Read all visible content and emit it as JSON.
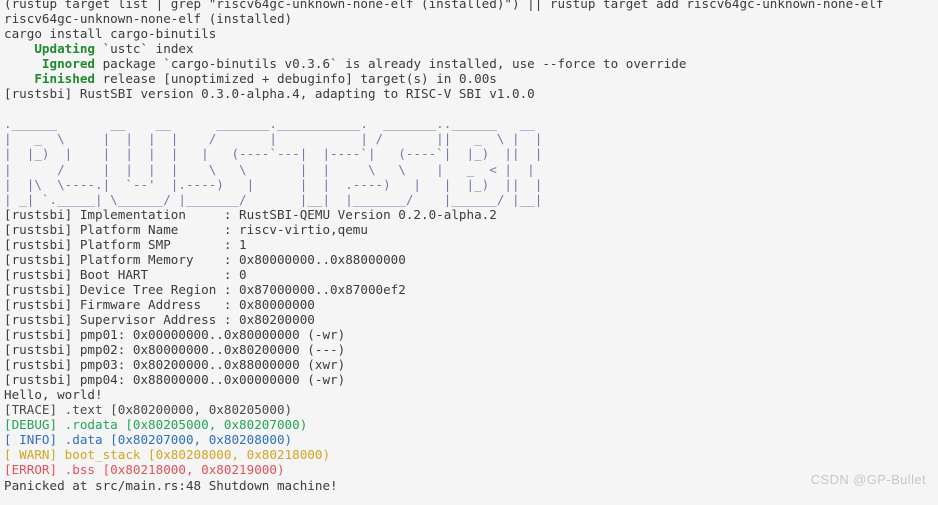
{
  "terminal": {
    "background_color": "#f5f5f5",
    "foreground_color": "#3b3b3b",
    "ascii_art_color": "#6b7da8",
    "colors": {
      "green": "#1f8a2e",
      "trace": "#4a4a4a",
      "debug": "#23a455",
      "info": "#2b6fc4",
      "warn": "#d3a520",
      "error": "#e05260",
      "watermark": "#c7c7c7"
    },
    "lines": [
      {
        "id": "cmd-rustup-target",
        "segments": [
          {
            "text": "(rustup target list | grep \"riscv64gc-unknown-none-elf (installed)\") || rustup target add riscv64gc-unknown-none-elf",
            "style": "c-default"
          }
        ]
      },
      {
        "id": "out-target-installed",
        "segments": [
          {
            "text": "riscv64gc-unknown-none-elf (installed)",
            "style": "c-default"
          }
        ]
      },
      {
        "id": "cmd-cargo-install",
        "segments": [
          {
            "text": "cargo install cargo-binutils",
            "style": "c-default"
          }
        ]
      },
      {
        "id": "out-updating",
        "segments": [
          {
            "text": "    ",
            "style": "c-default"
          },
          {
            "text": "Updating",
            "style": "c-green"
          },
          {
            "text": " `ustc` index",
            "style": "c-default"
          }
        ]
      },
      {
        "id": "out-ignored",
        "segments": [
          {
            "text": "     ",
            "style": "c-default"
          },
          {
            "text": "Ignored",
            "style": "c-green"
          },
          {
            "text": " package `cargo-binutils v0.3.6` is already installed, use --force to override",
            "style": "c-default"
          }
        ]
      },
      {
        "id": "out-finished",
        "segments": [
          {
            "text": "    ",
            "style": "c-default"
          },
          {
            "text": "Finished",
            "style": "c-green"
          },
          {
            "text": " release [unoptimized + debuginfo] target(s) in 0.00s",
            "style": "c-default"
          }
        ]
      },
      {
        "id": "rustsbi-version",
        "segments": [
          {
            "text": "[rustsbi] RustSBI version 0.3.0-alpha.4, adapting to RISC-V SBI v1.0.0",
            "style": "c-default"
          }
        ]
      },
      {
        "id": "blank-1",
        "segments": [
          {
            "text": "",
            "style": "c-default"
          }
        ]
      },
      {
        "id": "ascii-art-1",
        "segments": [
          {
            "text": ".______       __    __      _______.___________.  _______..______   __",
            "style": "art"
          }
        ]
      },
      {
        "id": "ascii-art-2",
        "segments": [
          {
            "text": "|   _  \\     |  |  |  |    /       |           | /       ||   _  \\ |  |",
            "style": "art"
          }
        ]
      },
      {
        "id": "ascii-art-3",
        "segments": [
          {
            "text": "|  |_)  |    |  |  |  |   |   (----`---|  |----`|   (----`|  |_)  ||  |",
            "style": "art"
          }
        ]
      },
      {
        "id": "ascii-art-4",
        "segments": [
          {
            "text": "|      /     |  |  |  |    \\   \\       |  |     \\   \\    |   _  < |  |",
            "style": "art"
          }
        ]
      },
      {
        "id": "ascii-art-5",
        "segments": [
          {
            "text": "|  |\\  \\----.|  `--'  |.----)   |      |  |  .----)   |   |  |_)  ||  |",
            "style": "art"
          }
        ]
      },
      {
        "id": "ascii-art-6",
        "segments": [
          {
            "text": "| _| `._____| \\______/ |_______/       |__|  |_______/    |______/ |__|",
            "style": "art"
          }
        ]
      },
      {
        "id": "rustsbi-implementation",
        "segments": [
          {
            "text": "[rustsbi] Implementation     : RustSBI-QEMU Version 0.2.0-alpha.2",
            "style": "c-default"
          }
        ]
      },
      {
        "id": "rustsbi-platform-name",
        "segments": [
          {
            "text": "[rustsbi] Platform Name      : riscv-virtio,qemu",
            "style": "c-default"
          }
        ]
      },
      {
        "id": "rustsbi-platform-smp",
        "segments": [
          {
            "text": "[rustsbi] Platform SMP       : 1",
            "style": "c-default"
          }
        ]
      },
      {
        "id": "rustsbi-platform-memory",
        "segments": [
          {
            "text": "[rustsbi] Platform Memory    : 0x80000000..0x88000000",
            "style": "c-default"
          }
        ]
      },
      {
        "id": "rustsbi-boot-hart",
        "segments": [
          {
            "text": "[rustsbi] Boot HART          : 0",
            "style": "c-default"
          }
        ]
      },
      {
        "id": "rustsbi-device-tree-region",
        "segments": [
          {
            "text": "[rustsbi] Device Tree Region : 0x87000000..0x87000ef2",
            "style": "c-default"
          }
        ]
      },
      {
        "id": "rustsbi-firmware-address",
        "segments": [
          {
            "text": "[rustsbi] Firmware Address   : 0x80000000",
            "style": "c-default"
          }
        ]
      },
      {
        "id": "rustsbi-supervisor-address",
        "segments": [
          {
            "text": "[rustsbi] Supervisor Address : 0x80200000",
            "style": "c-default"
          }
        ]
      },
      {
        "id": "rustsbi-pmp01",
        "segments": [
          {
            "text": "[rustsbi] pmp01: 0x00000000..0x80000000 (-wr)",
            "style": "c-default"
          }
        ]
      },
      {
        "id": "rustsbi-pmp02",
        "segments": [
          {
            "text": "[rustsbi] pmp02: 0x80000000..0x80200000 (---)",
            "style": "c-default"
          }
        ]
      },
      {
        "id": "rustsbi-pmp03",
        "segments": [
          {
            "text": "[rustsbi] pmp03: 0x80200000..0x88000000 (xwr)",
            "style": "c-default"
          }
        ]
      },
      {
        "id": "rustsbi-pmp04",
        "segments": [
          {
            "text": "[rustsbi] pmp04: 0x88000000..0x00000000 (-wr)",
            "style": "c-default"
          }
        ]
      },
      {
        "id": "hello-world",
        "segments": [
          {
            "text": "Hello, world!",
            "style": "c-default"
          }
        ]
      },
      {
        "id": "log-trace-text",
        "segments": [
          {
            "text": "[TRACE] .text [0x80200000, 0x80205000)",
            "style": "c-trace"
          }
        ]
      },
      {
        "id": "log-debug-rodata",
        "segments": [
          {
            "text": "[DEBUG] .rodata [0x80205000, 0x80207000)",
            "style": "c-debug"
          }
        ]
      },
      {
        "id": "log-info-data",
        "segments": [
          {
            "text": "[ INFO] .data [0x80207000, 0x80208000)",
            "style": "c-info"
          }
        ]
      },
      {
        "id": "log-warn-boot-stack",
        "segments": [
          {
            "text": "[ WARN] boot_stack [0x80208000, 0x80218000)",
            "style": "c-warn"
          }
        ]
      },
      {
        "id": "log-error-bss",
        "segments": [
          {
            "text": "[ERROR] .bss [0x80218000, 0x80219000)",
            "style": "c-error"
          }
        ]
      },
      {
        "id": "panic-message",
        "segments": [
          {
            "text": "Panicked at src/main.rs:48 Shutdown machine!",
            "style": "c-default"
          }
        ]
      }
    ]
  },
  "watermark": {
    "text": "CSDN @GP-Bullet"
  }
}
